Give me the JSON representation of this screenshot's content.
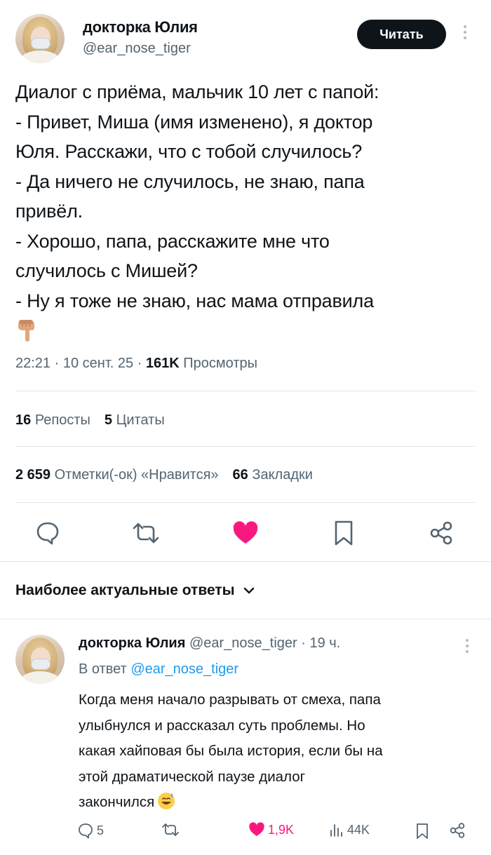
{
  "tweet": {
    "author_name": "докторка Юлия",
    "author_handle": "@ear_nose_tiger",
    "follow_label": "Читать",
    "text": "Диалог с приёма, мальчик 10 лет с папой:\n- Привет, Миша (имя изменено), я доктор\nЮля. Расскажи, что с тобой случилось?\n- Да ничего не случилось, не знаю, папа\nпривёл.\n- Хорошо, папа, расскажите мне что\nслучилось с Мишей?\n- Ну я тоже не знаю, нас мама отправила",
    "emoji": "pointing-down-hand",
    "time": "22:21",
    "date": "10 сент. 25",
    "views_count": "161K",
    "views_label": "Просмотры",
    "reposts_count": "16",
    "reposts_label": "Репосты",
    "quotes_count": "5",
    "quotes_label": "Цитаты",
    "likes_count": "2 659",
    "likes_label": "Отметки(-ок) «Нравится»",
    "bookmarks_count": "66",
    "bookmarks_label": "Закладки",
    "liked": true,
    "like_color": "#f91880"
  },
  "actions": [
    "reply-icon",
    "retweet-icon",
    "heart-icon",
    "bookmark-icon",
    "share-icon"
  ],
  "replies_section": {
    "title": "Наиболее актуальные ответы"
  },
  "reply": {
    "author_name": "докторка Юлия",
    "author_handle": "@ear_nose_tiger",
    "time_ago": "19 ч.",
    "reply_to_prefix": "В ответ",
    "reply_to_handle": "@ear_nose_tiger",
    "text": "Когда меня начало разрывать от смеха, папа\nулыбнулся и рассказал суть проблемы. Но\nкакая хайповая бы была история, если бы на\nэтой драматической паузе диалог\nзакончился",
    "emoji": "grinning-sweat-face",
    "replies_count": "5",
    "likes_count": "1,9K",
    "views_count": "44K",
    "mention_color": "#1d9bf0"
  }
}
